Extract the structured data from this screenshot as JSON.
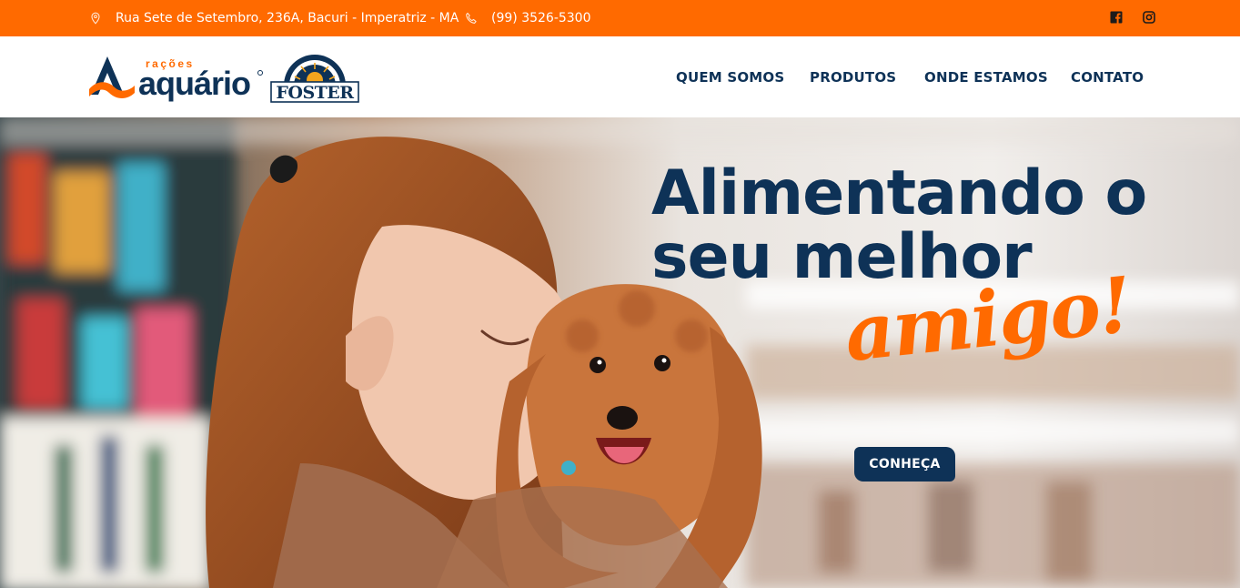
{
  "topbar": {
    "address": "Rua Sete de Setembro, 236A, Bacuri - Imperatriz - MA",
    "phone": "(99) 3526-5300",
    "social": [
      "facebook-icon",
      "instagram-icon"
    ]
  },
  "brand": {
    "aquario_small": "rações",
    "aquario_name": "aquário",
    "foster_name": "FOSTER"
  },
  "nav": {
    "items": [
      "QUEM SOMOS",
      "PRODUTOS",
      "ONDE ESTAMOS",
      "CONTATO"
    ]
  },
  "hero": {
    "line1": "Alimentando o",
    "line2": "seu melhor",
    "script": "amigo!",
    "cta_label": "CONHEÇA"
  },
  "colors": {
    "accent": "#ff6a00",
    "primary": "#0e3257",
    "white": "#ffffff"
  }
}
